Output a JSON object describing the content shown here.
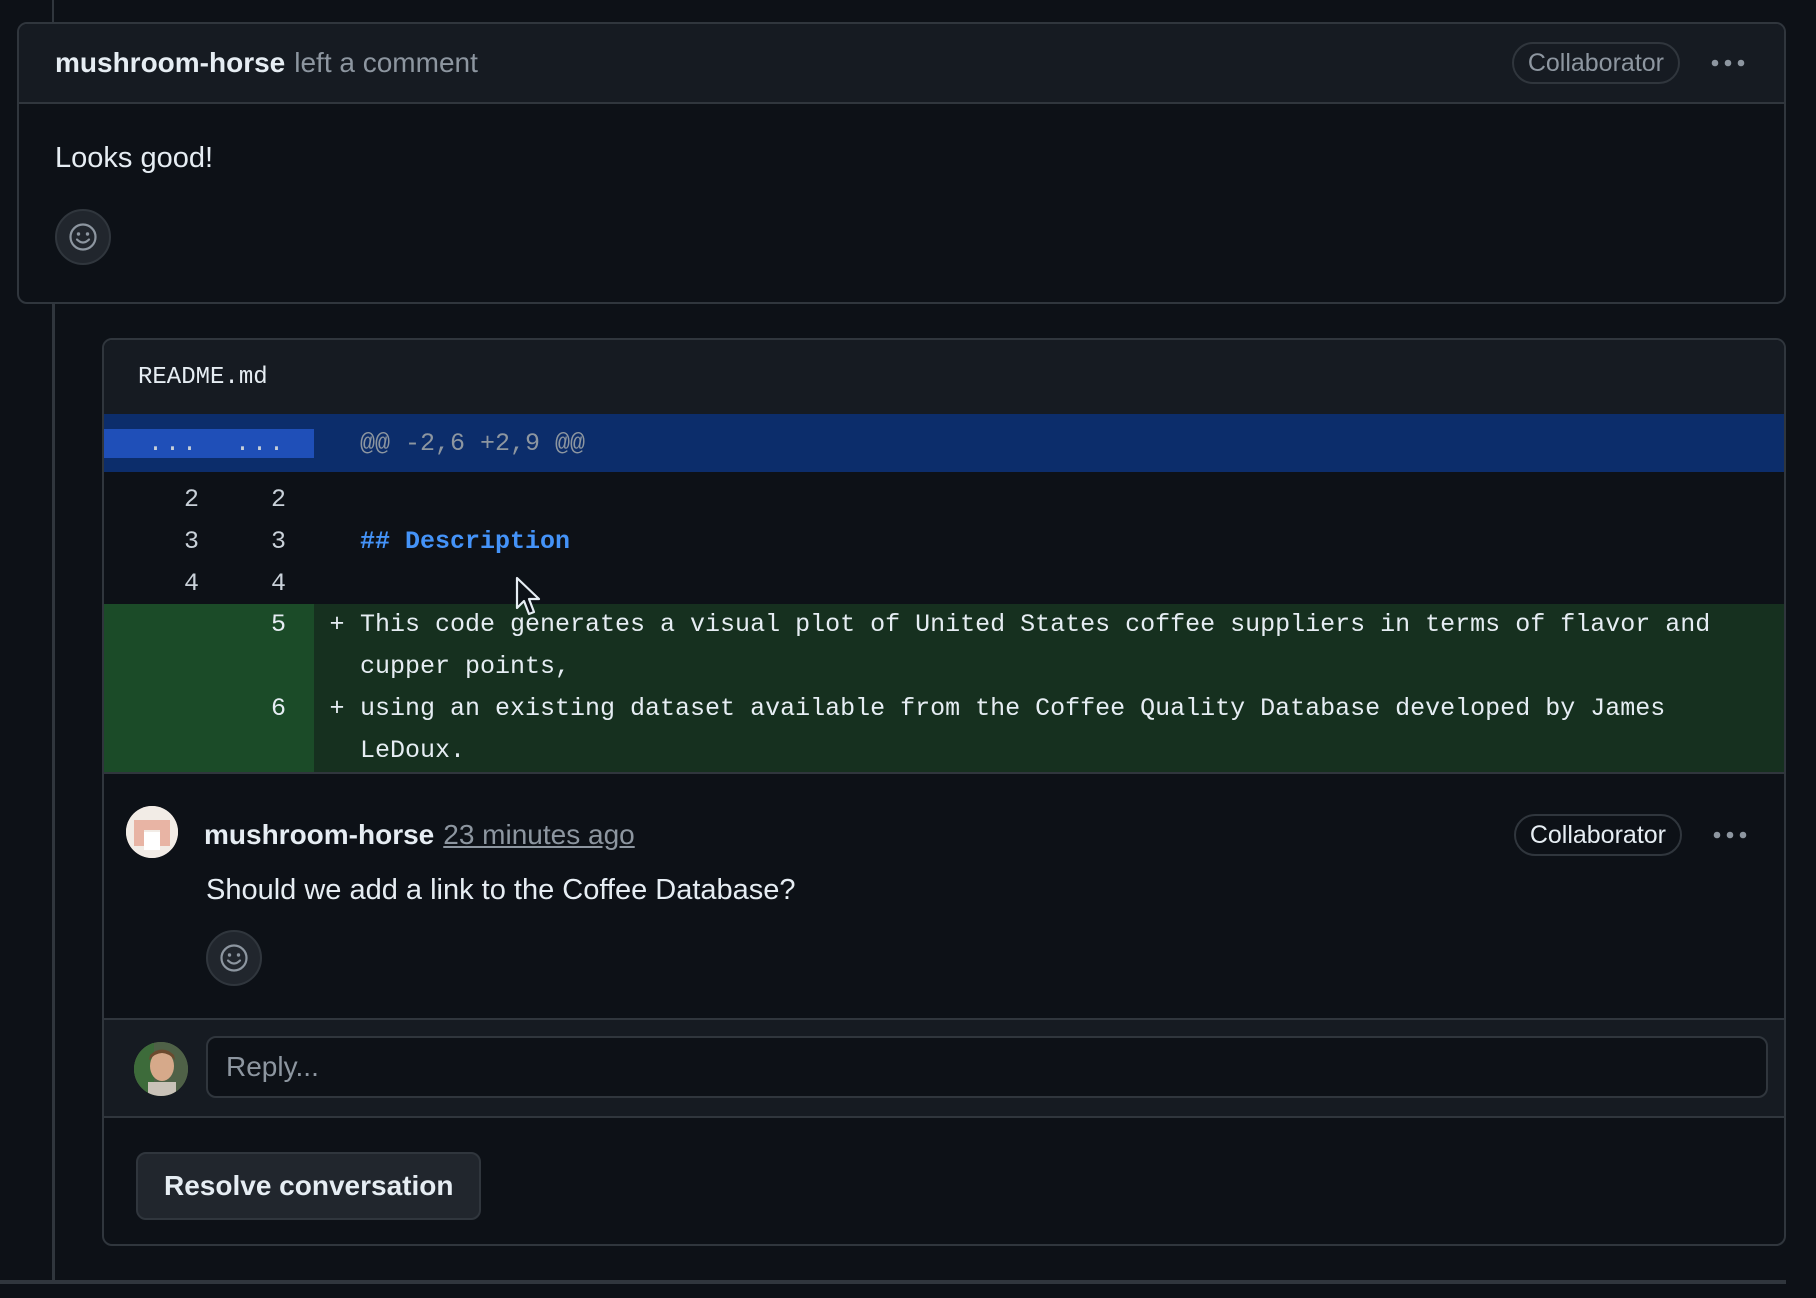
{
  "top_comment": {
    "author": "mushroom-horse",
    "action": "left a comment",
    "badge": "Collaborator",
    "menu_icon": "kebab-horizontal-icon",
    "body": "Looks good!",
    "reaction_icon": "smiley-icon"
  },
  "thread": {
    "file_name": "README.md",
    "diff": {
      "hunk_left": "...",
      "hunk_right": "...",
      "hunk_header": "@@ -2,6 +2,9 @@",
      "context": [
        {
          "old": "2",
          "new": "2",
          "text": ""
        },
        {
          "old": "3",
          "new": "3",
          "text": "## Description"
        },
        {
          "old": "4",
          "new": "4",
          "text": ""
        }
      ],
      "additions": [
        {
          "new": "5",
          "sign": "+",
          "text": "This code generates a visual plot of United States coffee suppliers in terms of flavor and cupper points,"
        },
        {
          "new": "6",
          "sign": "+",
          "text": "using an existing dataset available from the Coffee Quality Database developed by James LeDoux."
        }
      ]
    },
    "review_comment": {
      "author": "mushroom-horse",
      "time": "23 minutes ago",
      "badge": "Collaborator",
      "menu_icon": "kebab-horizontal-icon",
      "body": "Should we add a link to the Coffee Database?",
      "reaction_icon": "smiley-icon"
    },
    "reply": {
      "placeholder": "Reply..."
    },
    "resolve_label": "Resolve conversation"
  },
  "colors": {
    "background": "#0d1117",
    "header_bg": "#161b22",
    "border": "#30363d",
    "hunk_bg": "#0c2d6b",
    "add_bg": "#16301f",
    "heading_blue": "#4493f8"
  }
}
